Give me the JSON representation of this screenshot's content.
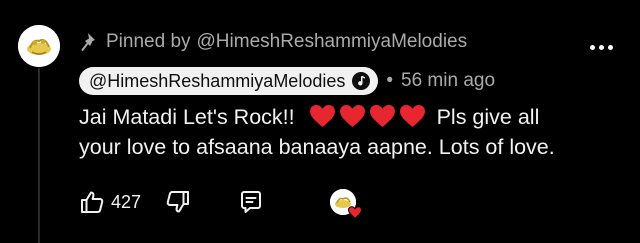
{
  "pinned": {
    "prefix": "Pinned by",
    "pinner": "@HimeshReshammiyaMelodies"
  },
  "comment": {
    "author": "@HimeshReshammiyaMelodies",
    "separator": "•",
    "time": "56 min ago",
    "text_before": "Jai Matadi Let's Rock!!",
    "emoji_count": 4,
    "emoji": "red-heart",
    "text_after_line1": "Pls give all",
    "text_line2": "your love to afsaana banaaya aapne. Lots of love."
  },
  "actions": {
    "like_count": "427"
  },
  "colors": {
    "background": "#000000",
    "text": "#f1f1f1",
    "secondary_text": "#aaaaaa",
    "chip_background": "#f1f1f1",
    "heart": "#e8262f"
  },
  "icons": {
    "pin": "pin-icon",
    "verified": "music-note-verified-icon",
    "more": "more-vertical-icon",
    "like": "thumbs-up-icon",
    "dislike": "thumbs-down-icon",
    "reply": "reply-comment-icon",
    "creator_heart": "creator-heart-icon"
  }
}
